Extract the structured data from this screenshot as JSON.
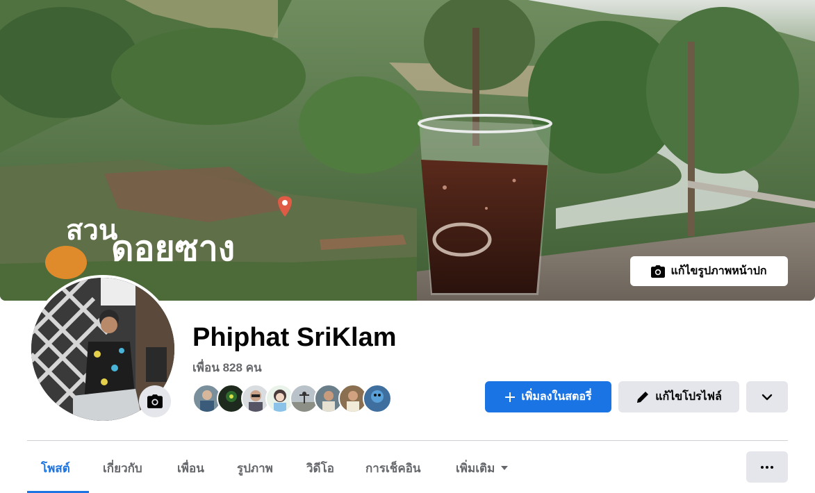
{
  "cover": {
    "edit_label": "แก้ไขรูปภาพหน้าปก",
    "sign_line1": "สวน",
    "sign_line2": "ดอยซาง"
  },
  "profile": {
    "name": "Phiphat SriKlam",
    "friends": "เพื่อน 828 คน"
  },
  "actions": {
    "add_story": "เพิ่มลงในสตอรี่",
    "edit_profile": "แก้ไขโปรไฟล์"
  },
  "tabs": [
    "โพสต์",
    "เกี่ยวกับ",
    "เพื่อน",
    "รูปภาพ",
    "วิดีโอ",
    "การเช็คอิน",
    "เพิ่มเติม"
  ],
  "colors": {
    "accent": "#1b74e4",
    "secondary_button": "#e4e6eb",
    "muted_text": "#65676b"
  },
  "icons": {
    "camera": "camera-icon",
    "plus": "plus-icon",
    "pencil": "pencil-icon",
    "chevron": "chevron-down-icon",
    "ellipsis": "ellipsis-icon"
  }
}
